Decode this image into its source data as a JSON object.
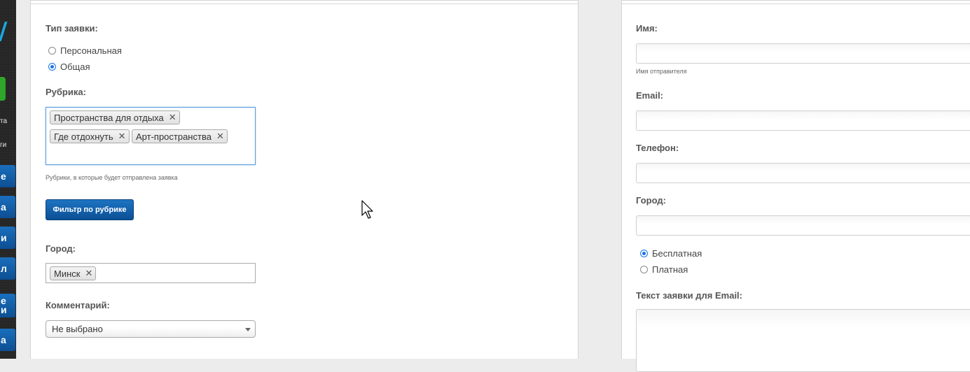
{
  "sidebar": {
    "text_1": "та",
    "text_2": "ги",
    "nav": [
      "е",
      "а",
      "и",
      "л",
      "е\nи",
      "а"
    ]
  },
  "left_form": {
    "type_label": "Тип заявки:",
    "type_options": [
      {
        "label": "Персональная",
        "checked": false
      },
      {
        "label": "Общая",
        "checked": true
      }
    ],
    "rubric_label": "Рубрика:",
    "rubric_tags": [
      "Пространства для отдыха",
      "Где отдохнуть",
      "Арт-пространства"
    ],
    "rubric_hint": "Рубрики, в которые будет отправлена заявка",
    "filter_button": "Фильтр по рубрике",
    "city_label": "Город:",
    "city_tags": [
      "Минск"
    ],
    "comment_label": "Комментарий:",
    "comment_value": "Не выбрано"
  },
  "right_form": {
    "name_label": "Имя:",
    "name_hint": "Имя отправителя",
    "email_label": "Email:",
    "phone_label": "Телефон:",
    "city_label": "Город:",
    "pay_options": [
      {
        "label": "Бесплатная",
        "checked": true
      },
      {
        "label": "Платная",
        "checked": false
      }
    ],
    "email_text_label": "Текст заявки для Email:"
  },
  "colors": {
    "accent_blue": "#1a73e8",
    "button_blue": "#0b4f95",
    "sidebar_green": "#2fa52a"
  }
}
